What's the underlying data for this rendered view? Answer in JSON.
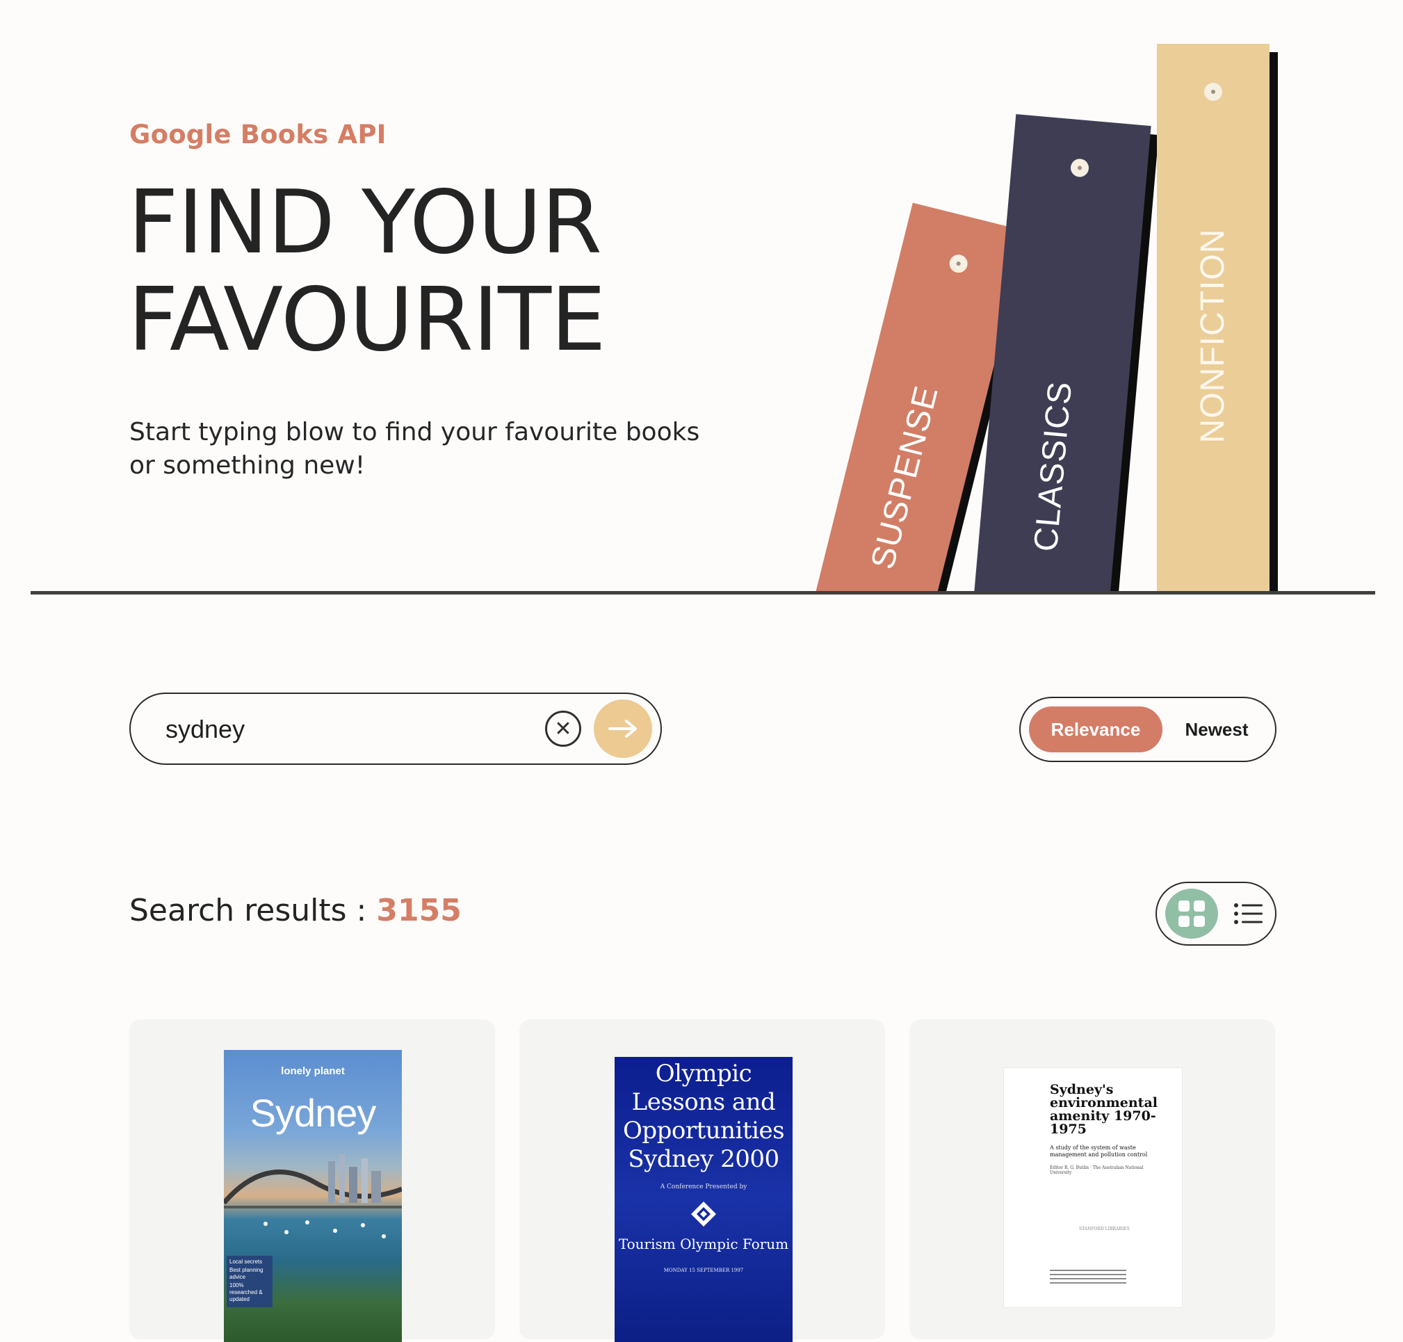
{
  "hero": {
    "eyebrow": "Google Books API",
    "title_line1": "FIND YOUR",
    "title_line2": "FAVOURITE",
    "subtitle": "Start typing blow to find your favourite books or something new!"
  },
  "shelf": {
    "books": [
      {
        "genre": "SUSPENSE",
        "color": "#d27d65"
      },
      {
        "genre": "CLASSICS",
        "color": "#3e3d54"
      },
      {
        "genre": "NONFICTION",
        "color": "#ebcd98"
      }
    ]
  },
  "search": {
    "value": "sydney",
    "clear_icon": "x-circle-icon",
    "submit_icon": "arrow-right-icon"
  },
  "sort": {
    "options": [
      "Relevance",
      "Newest"
    ],
    "selected": "Relevance"
  },
  "results": {
    "label": "Search results : ",
    "count": "3155"
  },
  "view_toggle": {
    "selected": "grid",
    "options": [
      "grid-icon",
      "list-icon"
    ]
  },
  "books": [
    {
      "cover_brand": "lonely planet",
      "cover_title": "Sydney",
      "cover_tags": [
        "Local secrets",
        "Best planning advice",
        "100% researched & updated"
      ]
    },
    {
      "cover_title": "Olympic Lessons and Opportunities Sydney 2000",
      "cover_sub": "A Conference Presented by",
      "cover_org": "Tourism Olympic Forum",
      "cover_foot": "MONDAY 15 SEPTEMBER 1997"
    },
    {
      "cover_title": "Sydney's environmental amenity 1970-1975",
      "cover_sub": "A study of the system of waste management and pollution control",
      "cover_editor": "Editor R. G. Butlin · The Australian National University",
      "cover_publisher": "STANFORD LIBRARIES"
    }
  ],
  "colors": {
    "accent": "#d47e65",
    "navy": "#3e3d54",
    "sand": "#ebcd98",
    "sage": "#91bfa6",
    "background": "#fdfcfa"
  }
}
